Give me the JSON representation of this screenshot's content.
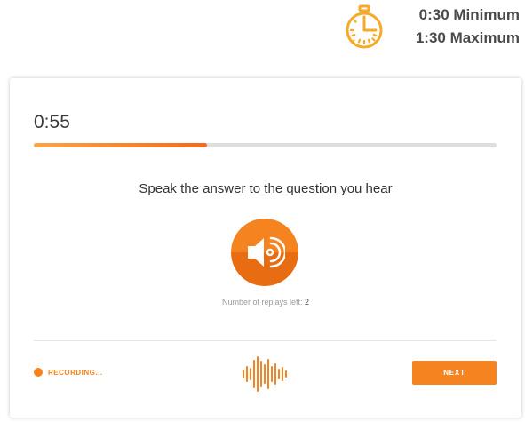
{
  "timer": {
    "icon": "stopwatch-icon",
    "minimum": "0:30 Minimum",
    "maximum": "1:30 Maximum"
  },
  "question": {
    "elapsed": "0:55",
    "progress_fraction": 0.375,
    "prompt": "Speak the answer to the question you hear",
    "play_icon": "speaker-icon",
    "replays_label": "Number of replays left: ",
    "replays_left": "2"
  },
  "footer": {
    "recording_label": "RECORDING...",
    "waveform_icon": "waveform-icon",
    "next_label": "NEXT"
  },
  "colors": {
    "accent": "#f58420",
    "timer_icon": "#f7a928",
    "text": "#333333"
  }
}
